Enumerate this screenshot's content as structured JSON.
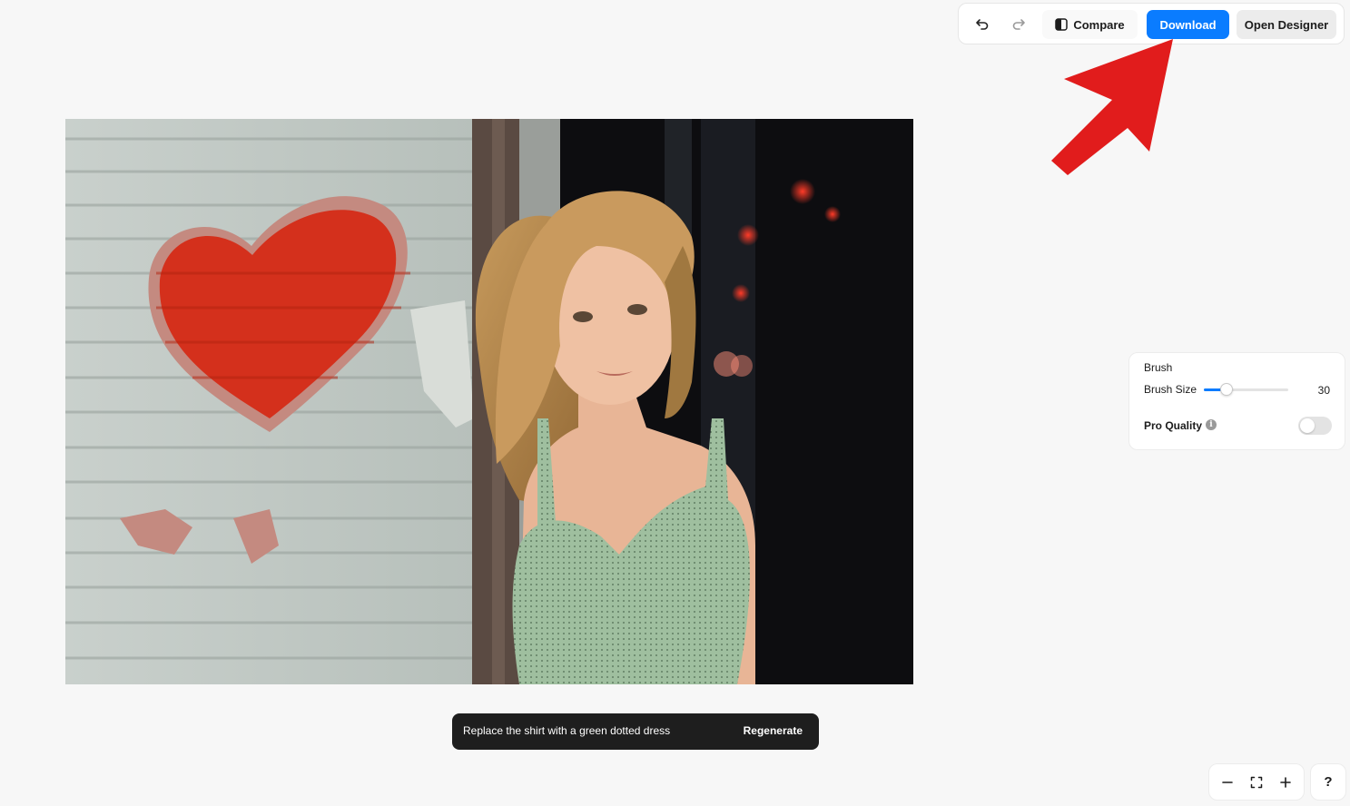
{
  "toolbar": {
    "undo_icon": "undo-icon",
    "redo_icon": "redo-icon",
    "compare_icon": "compare-icon",
    "compare_label": "Compare",
    "download_label": "Download",
    "open_designer_label": "Open Designer",
    "download_color": "#0a7cff"
  },
  "annotation": {
    "type": "arrow",
    "color": "#e11c1c",
    "points_to": "download-button"
  },
  "canvas": {
    "image_description_icon": "edited-photo"
  },
  "brush_panel": {
    "title": "Brush",
    "size_label": "Brush Size",
    "size_value": "30",
    "size_fraction": 0.27,
    "pro_quality_label": "Pro Quality",
    "info_icon": "info-icon",
    "pro_quality_enabled": false
  },
  "prompt_bar": {
    "text": "Replace the shirt with a green dotted dress",
    "regenerate_label": "Regenerate"
  },
  "zoom": {
    "zoom_out_icon": "minus-icon",
    "fit_icon": "fit-screen-icon",
    "zoom_in_icon": "plus-icon"
  },
  "help": {
    "label": "?"
  }
}
